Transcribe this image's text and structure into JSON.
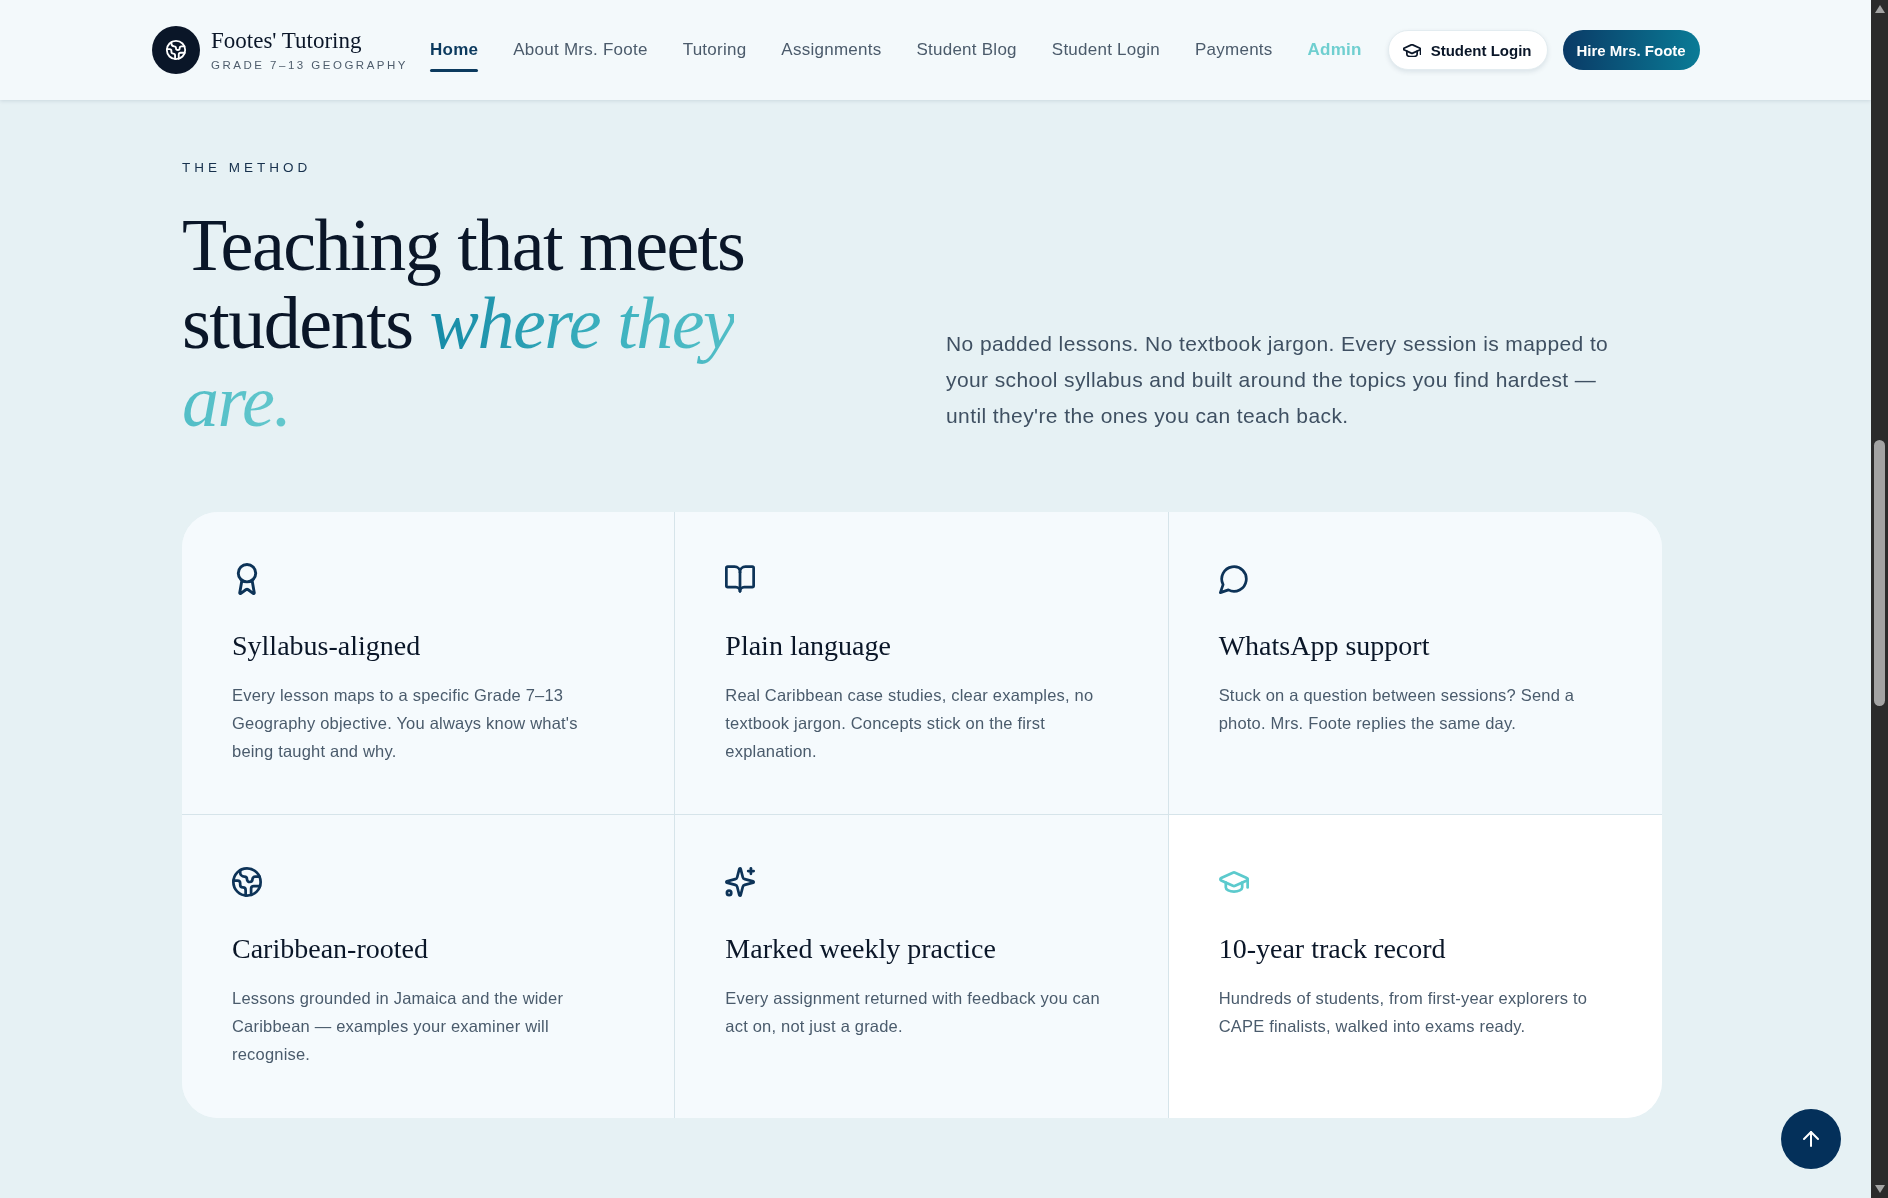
{
  "header": {
    "brand": {
      "name": "Footes' Tutoring",
      "tagline": "GRADE 7–13 GEOGRAPHY"
    },
    "nav": [
      {
        "label": "Home",
        "selected": true,
        "kind": "page"
      },
      {
        "label": "About Mrs. Foote",
        "selected": false,
        "kind": "page"
      },
      {
        "label": "Tutoring",
        "selected": false,
        "kind": "page"
      },
      {
        "label": "Assignments",
        "selected": false,
        "kind": "page"
      },
      {
        "label": "Student Blog",
        "selected": false,
        "kind": "page"
      },
      {
        "label": "Student Login",
        "selected": false,
        "kind": "page"
      },
      {
        "label": "Payments",
        "selected": false,
        "kind": "page"
      },
      {
        "label": "Admin",
        "selected": false,
        "kind": "admin"
      }
    ],
    "actions": [
      {
        "label": "Student Login",
        "kind": "secondary"
      },
      {
        "label": "Hire Mrs. Foote",
        "kind": "primary"
      }
    ]
  },
  "method": {
    "eyebrow": "THE METHOD",
    "heading": "Teaching that meets students *where they are.*",
    "intro": "No padded lessons. No textbook jargon. Every session is mapped to your school syllabus and built around the topics you find hardest — until they're the ones you can teach back.",
    "features": [
      {
        "title": "Syllabus-aligned",
        "text": "Every lesson maps to a specific Grade 7–13 Geography objective. You always know what's being taught and why.",
        "highlighted": false
      },
      {
        "title": "Plain language",
        "text": "Real Caribbean case studies, clear examples, no textbook jargon. Concepts stick on the first explanation.",
        "highlighted": false
      },
      {
        "title": "WhatsApp support",
        "text": "Stuck on a question between sessions? Send a photo. Mrs. Foote replies the same day.",
        "highlighted": false
      },
      {
        "title": "Caribbean-rooted",
        "text": "Lessons grounded in Jamaica and the wider Caribbean — examples your examiner will recognise.",
        "highlighted": false
      },
      {
        "title": "Marked weekly practice",
        "text": "Every assignment returned with feedback you can act on, not just a grade.",
        "highlighted": false
      },
      {
        "title": "10-year track record",
        "text": "Hundreds of students, from first-year explorers to CAPE finalists, walked into exams ready.",
        "highlighted": true
      }
    ]
  }
}
